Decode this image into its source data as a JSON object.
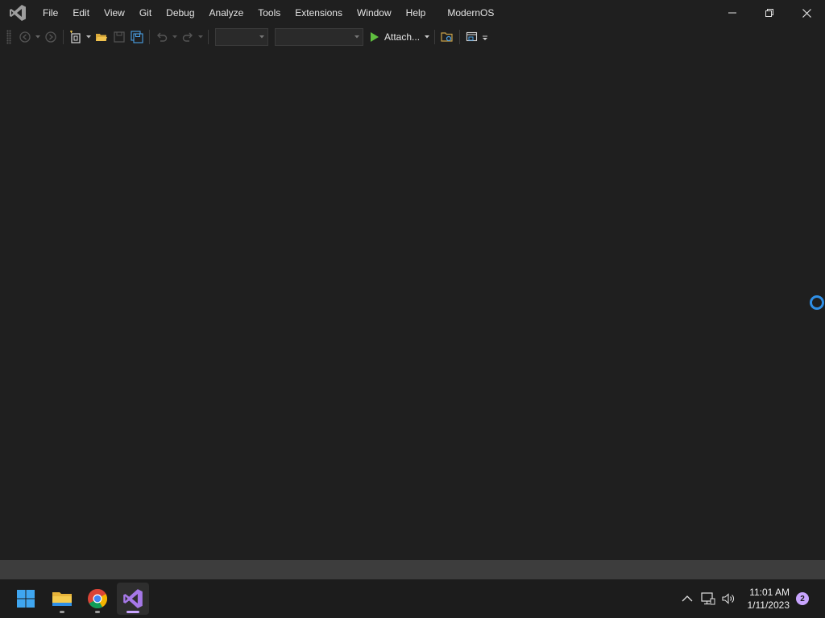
{
  "menu": {
    "items": [
      "File",
      "Edit",
      "View",
      "Git",
      "Debug",
      "Analyze",
      "Tools",
      "Extensions",
      "Window",
      "Help"
    ],
    "app_title": "ModernOS"
  },
  "toolbar": {
    "attach_label": "Attach...",
    "config_combo_value": "",
    "platform_combo_value": ""
  },
  "taskbar": {
    "apps": [
      "start-menu",
      "file-explorer",
      "chrome",
      "visual-studio"
    ],
    "clock_time": "11:01 AM",
    "clock_date": "1/11/2023",
    "notification_count": "2"
  },
  "colors": {
    "background": "#1f1f1f",
    "statusbar": "#3d3d3d",
    "taskbar": "#1c1c1c",
    "accent_purple": "#c9a5ff",
    "busy_blue": "#2f8fe6",
    "run_green": "#5fbf3f"
  }
}
